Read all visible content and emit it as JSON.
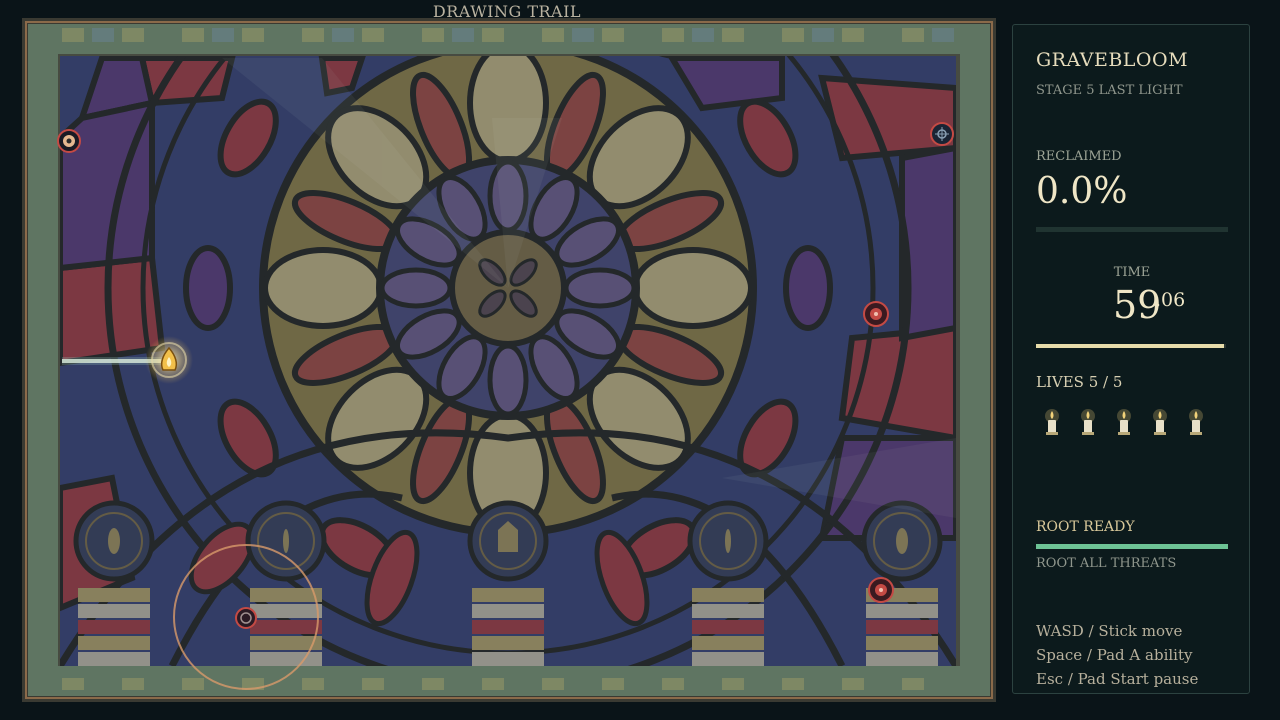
{
  "status": {
    "text": "DRAWING TRAIL"
  },
  "hud": {
    "title": "GRAVEBLOOM",
    "subtitle": "STAGE 5  LAST LIGHT",
    "reclaimed": {
      "label": "RECLAIMED",
      "value": "0.0%",
      "fraction": 0.0
    },
    "time": {
      "label": "TIME",
      "seconds": "59",
      "hundredths": ".06",
      "fraction": 0.99
    },
    "lives": {
      "label": "LIVES  5 / 5",
      "current": 5,
      "max": 5
    },
    "ability": {
      "status": "ROOT READY",
      "description": "ROOT ALL THREATS",
      "charge": 1.0
    },
    "controls": [
      "WASD / Stick move",
      "Space / Pad A ability",
      "Esc / Pad Start pause"
    ]
  },
  "colors": {
    "accent_gold": "#e7dcaa",
    "ability_green": "#6dc395",
    "enemy_red": "#c44a44",
    "player_gold": "#f2c04a"
  },
  "icons": {
    "player": "flame-spirit-icon",
    "enemy": "thorn-wisp-icon",
    "life": "candle-icon"
  }
}
